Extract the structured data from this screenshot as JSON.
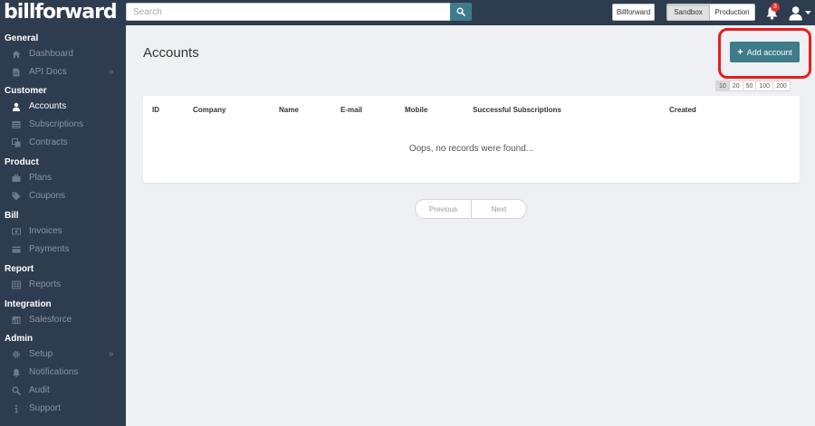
{
  "app": {
    "logo": "billforward"
  },
  "header": {
    "search_placeholder": "Search",
    "search_button_icon": "search-icon",
    "account_button": "Billforward",
    "env_options": [
      "Sandbox",
      "Production"
    ],
    "env_selected": "Sandbox",
    "notification_count": "3",
    "notification_icon": "bell-icon",
    "user_icon": "user-icon"
  },
  "sidebar": {
    "sections": [
      {
        "title": "General",
        "items": [
          {
            "label": "Dashboard",
            "icon": "home-icon"
          },
          {
            "label": "API Docs",
            "icon": "document-icon",
            "expandable": true
          }
        ]
      },
      {
        "title": "Customer",
        "items": [
          {
            "label": "Accounts",
            "icon": "user-icon",
            "active": true
          },
          {
            "label": "Subscriptions",
            "icon": "list-icon"
          },
          {
            "label": "Contracts",
            "icon": "contracts-icon"
          }
        ]
      },
      {
        "title": "Product",
        "items": [
          {
            "label": "Plans",
            "icon": "briefcase-icon"
          },
          {
            "label": "Coupons",
            "icon": "tag-icon"
          }
        ]
      },
      {
        "title": "Bill",
        "items": [
          {
            "label": "Invoices",
            "icon": "money-icon"
          },
          {
            "label": "Payments",
            "icon": "credit-card-icon"
          }
        ]
      },
      {
        "title": "Report",
        "items": [
          {
            "label": "Reports",
            "icon": "table-icon"
          }
        ]
      },
      {
        "title": "Integration",
        "items": [
          {
            "label": "Salesforce",
            "icon": "dashboard-icon"
          }
        ]
      },
      {
        "title": "Admin",
        "items": [
          {
            "label": "Setup",
            "icon": "gear-icon",
            "expandable": true
          },
          {
            "label": "Notifications",
            "icon": "bell-icon"
          },
          {
            "label": "Audit",
            "icon": "search-icon"
          },
          {
            "label": "Support",
            "icon": "info-icon"
          }
        ]
      }
    ]
  },
  "main": {
    "title": "Accounts",
    "add_button": "Add account",
    "page_sizes": [
      "10",
      "20",
      "50",
      "100",
      "200"
    ],
    "page_size_selected": "10",
    "table": {
      "columns": [
        "ID",
        "Company",
        "Name",
        "E-mail",
        "Mobile",
        "Successful Subscriptions",
        "Created"
      ],
      "empty_message": "Oops, no records were found..."
    },
    "pager": {
      "previous": "Previous",
      "next": "Next"
    }
  },
  "colors": {
    "sidebar_bg": "#2e3c50",
    "accent": "#3e7b8b",
    "page_bg": "#eef0f4",
    "highlight": "#e81d1d",
    "badge": "#e3342f"
  }
}
